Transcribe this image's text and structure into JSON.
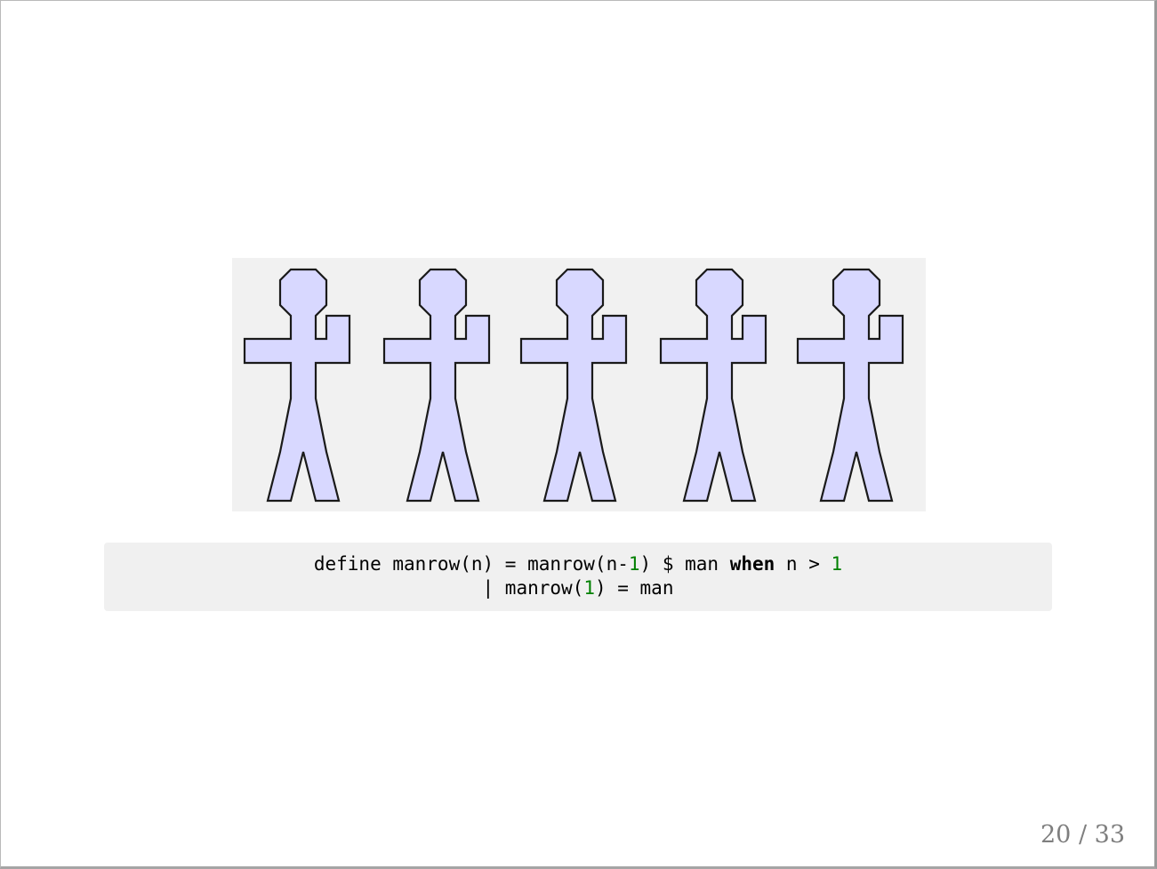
{
  "figure": {
    "figure_count": 5,
    "fill_color": "#d8d8ff",
    "stroke_color": "#1a1a1a",
    "background_color": "#f1f1f1",
    "icon": "stick-figure-icon"
  },
  "code": {
    "line1": {
      "t1": "define manrow(n) = manrow(n-",
      "n1": "1",
      "t2": ") $ man ",
      "kw": "when",
      "t3": " n > ",
      "n2": "1"
    },
    "line2": {
      "t1": "| manrow(",
      "n1": "1",
      "t2": ") = man"
    },
    "number_color": "#008000"
  },
  "page": {
    "current": "20",
    "separator": "/",
    "total": "33"
  }
}
